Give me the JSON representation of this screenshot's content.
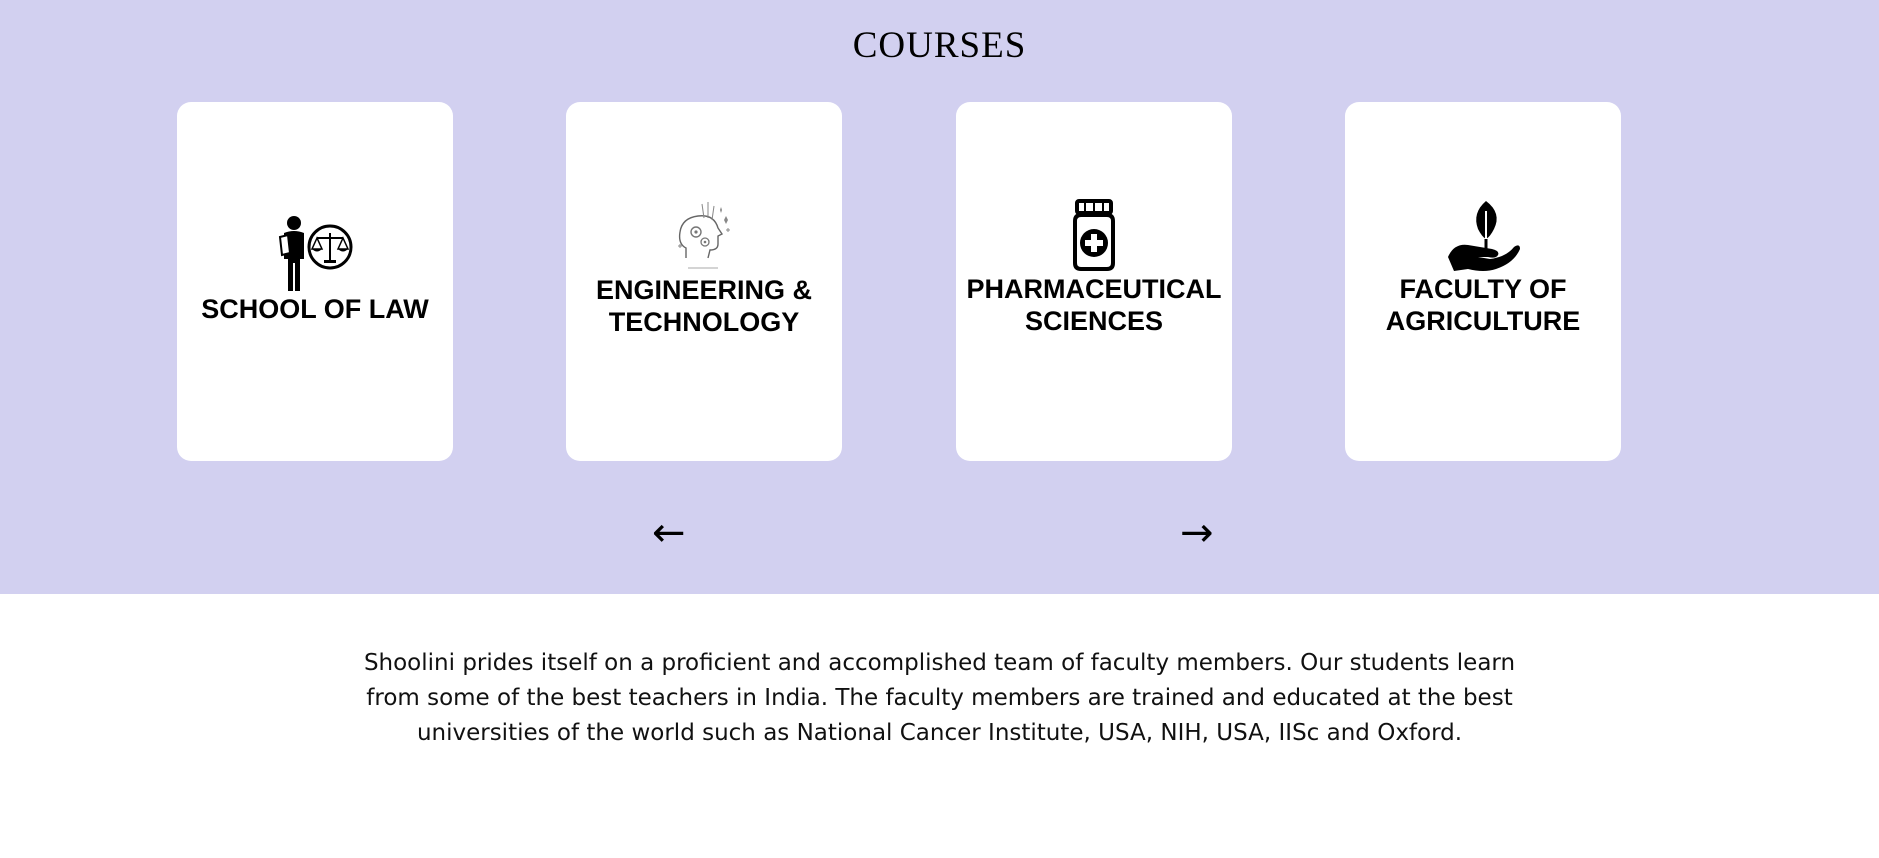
{
  "section": {
    "title": "COURSES",
    "background": "#d2d0f0"
  },
  "cards": [
    {
      "label": "SCHOOL OF LAW",
      "icon": "lawyer-scales-icon"
    },
    {
      "label": "ENGINEERING &\nTECHNOLOGY",
      "icon": "brain-gears-icon"
    },
    {
      "label": "PHARMACEUTICAL\nSCIENCES",
      "icon": "medicine-bottle-icon"
    },
    {
      "label": "FACULTY OF\nAGRICULTURE",
      "icon": "hand-leaf-icon"
    }
  ],
  "nav": {
    "prev": "←",
    "next": "→"
  },
  "about": {
    "text": "Shoolini prides itself on a proficient and accomplished team of faculty members. Our students learn from some of the best teachers in India. The faculty members are trained and educated at the best universities of the world such as National Cancer Institute, USA, NIH, USA, IISc and Oxford."
  }
}
